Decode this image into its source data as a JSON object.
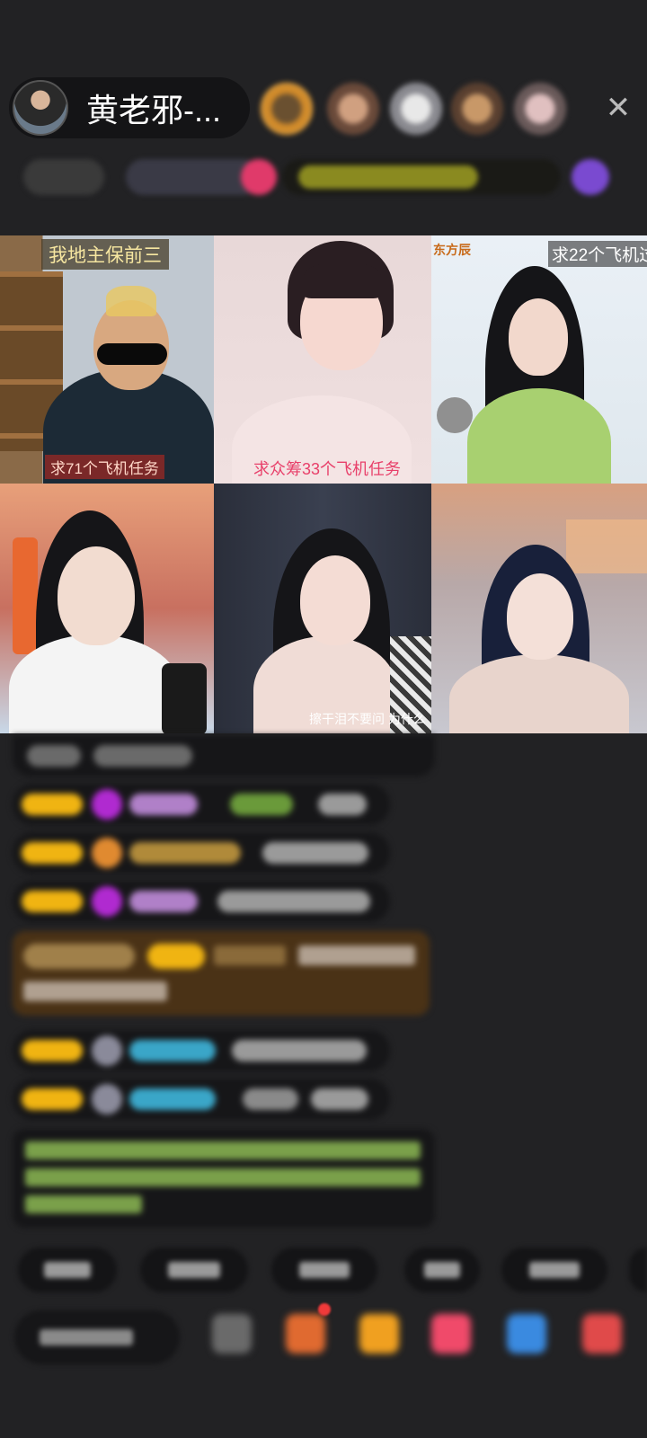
{
  "host": {
    "name": "黄老邪-..."
  },
  "viewer_avatars": [
    {
      "label": "viewer-1"
    },
    {
      "label": "viewer-2"
    },
    {
      "label": "viewer-3"
    },
    {
      "label": "viewer-4"
    },
    {
      "label": "viewer-5"
    }
  ],
  "icons": {
    "close": "close-icon"
  },
  "video_tiles": [
    {
      "top_caption": "我地主保前三",
      "bottom_caption": "求71个飞机任务"
    },
    {
      "bottom_caption": "求众筹33个飞机任务"
    },
    {
      "corner_text": "东方辰",
      "top_caption": "求22个飞机过"
    },
    {},
    {
      "bottom_caption": "擦干泪不要问 为什么"
    },
    {}
  ],
  "colors": {
    "background": "#222224",
    "panel": "#141416",
    "badge_gold": "#f0b412",
    "badge_purple": "#b02ad0",
    "name_cyan": "#3aa6c8",
    "system_green": "#9ac85a",
    "highlight_brown": "#4a3216"
  }
}
